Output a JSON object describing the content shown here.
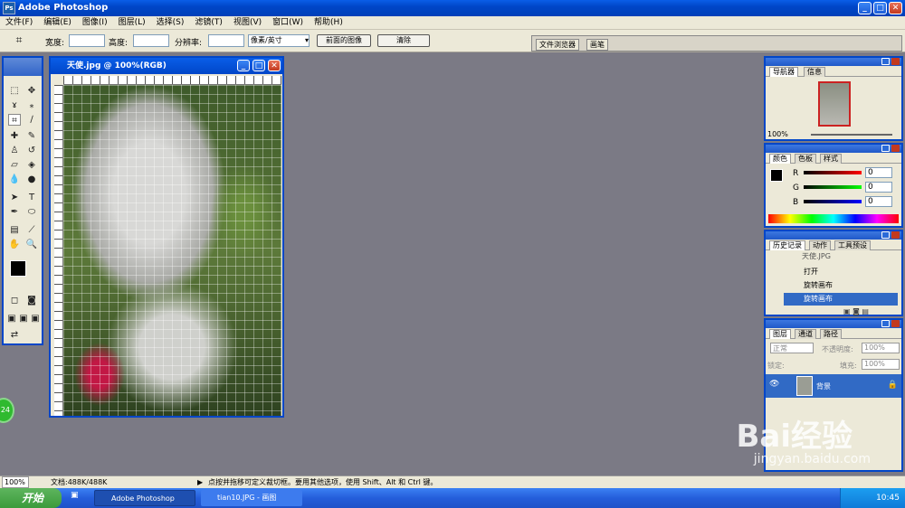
{
  "app": {
    "title": "Adobe Photoshop"
  },
  "menu": [
    "文件(F)",
    "编辑(E)",
    "图像(I)",
    "图层(L)",
    "选择(S)",
    "滤镜(T)",
    "视图(V)",
    "窗口(W)",
    "帮助(H)"
  ],
  "options": {
    "width_label": "宽度:",
    "height_label": "高度:",
    "resolution_label": "分辨率:",
    "unit": "像素/英寸",
    "front_image": "前面的图像",
    "clear": "清除",
    "file_browser": "文件浏览器",
    "brushes": "画笔"
  },
  "document": {
    "title": "天使.jpg @ 100%(RGB)"
  },
  "navigator": {
    "tabs": [
      "导航器",
      "信息"
    ],
    "zoom": "100%"
  },
  "color": {
    "tabs": [
      "颜色",
      "色板",
      "样式"
    ],
    "r": "0",
    "g": "0",
    "b": "0",
    "r_label": "R",
    "g_label": "G",
    "b_label": "B"
  },
  "history": {
    "tabs": [
      "历史记录",
      "动作",
      "工具预设"
    ],
    "snapshot": "天使.JPG",
    "items": [
      "打开",
      "旋转画布",
      "旋转画布"
    ]
  },
  "layers": {
    "tabs": [
      "图层",
      "通道",
      "路径"
    ],
    "mode": "正常",
    "opacity_label": "不透明度:",
    "opacity": "100%",
    "lock_label": "锁定:",
    "fill_label": "填充:",
    "fill": "100%",
    "layer_name": "背景"
  },
  "status": {
    "zoom": "100%",
    "doc": "文档:488K/488K",
    "hint": "点按并拖移可定义裁切框。要用其他选项，使用 Shift、Alt 和 Ctrl 键。"
  },
  "taskbar": {
    "start": "开始",
    "tasks": [
      "Adobe Photoshop",
      "tian10.JPG - 画图"
    ],
    "time": "10:45"
  },
  "watermark": {
    "brand": "Bai经验",
    "url": "jingyan.baidu.com"
  },
  "badge": "24"
}
